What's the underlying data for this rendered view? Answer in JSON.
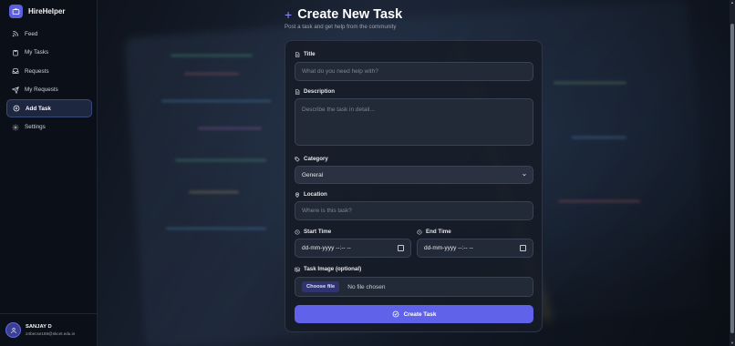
{
  "app": {
    "name": "HireHelper"
  },
  "sidebar": {
    "items": [
      {
        "label": "Feed",
        "icon": "rss-icon",
        "active": false
      },
      {
        "label": "My Tasks",
        "icon": "clipboard-icon",
        "active": false
      },
      {
        "label": "Requests",
        "icon": "inbox-icon",
        "active": false
      },
      {
        "label": "My Requests",
        "icon": "send-icon",
        "active": false
      },
      {
        "label": "Add Task",
        "icon": "plus-circle-icon",
        "active": true
      },
      {
        "label": "Settings",
        "icon": "gear-icon",
        "active": false
      }
    ]
  },
  "user": {
    "name": "SANJAY D",
    "email": "24becse169@skcet.edu.in"
  },
  "header": {
    "title": "Create New Task",
    "subtitle": "Post a task and get help from the community"
  },
  "form": {
    "title_label": "Title",
    "title_placeholder": "What do you need help with?",
    "description_label": "Description",
    "description_placeholder": "Describe the task in detail...",
    "category_label": "Category",
    "category_value": "General",
    "location_label": "Location",
    "location_placeholder": "Where is this task?",
    "start_label": "Start Time",
    "start_value": "dd-mm-yyyy --:-- --",
    "end_label": "End Time",
    "end_value": "dd-mm-yyyy --:-- --",
    "image_label": "Task Image (optional)",
    "file_button": "Choose file",
    "file_status": "No file chosen",
    "submit_label": "Create Task"
  },
  "colors": {
    "accent": "#6063ea",
    "active_nav": "#1e2740"
  }
}
